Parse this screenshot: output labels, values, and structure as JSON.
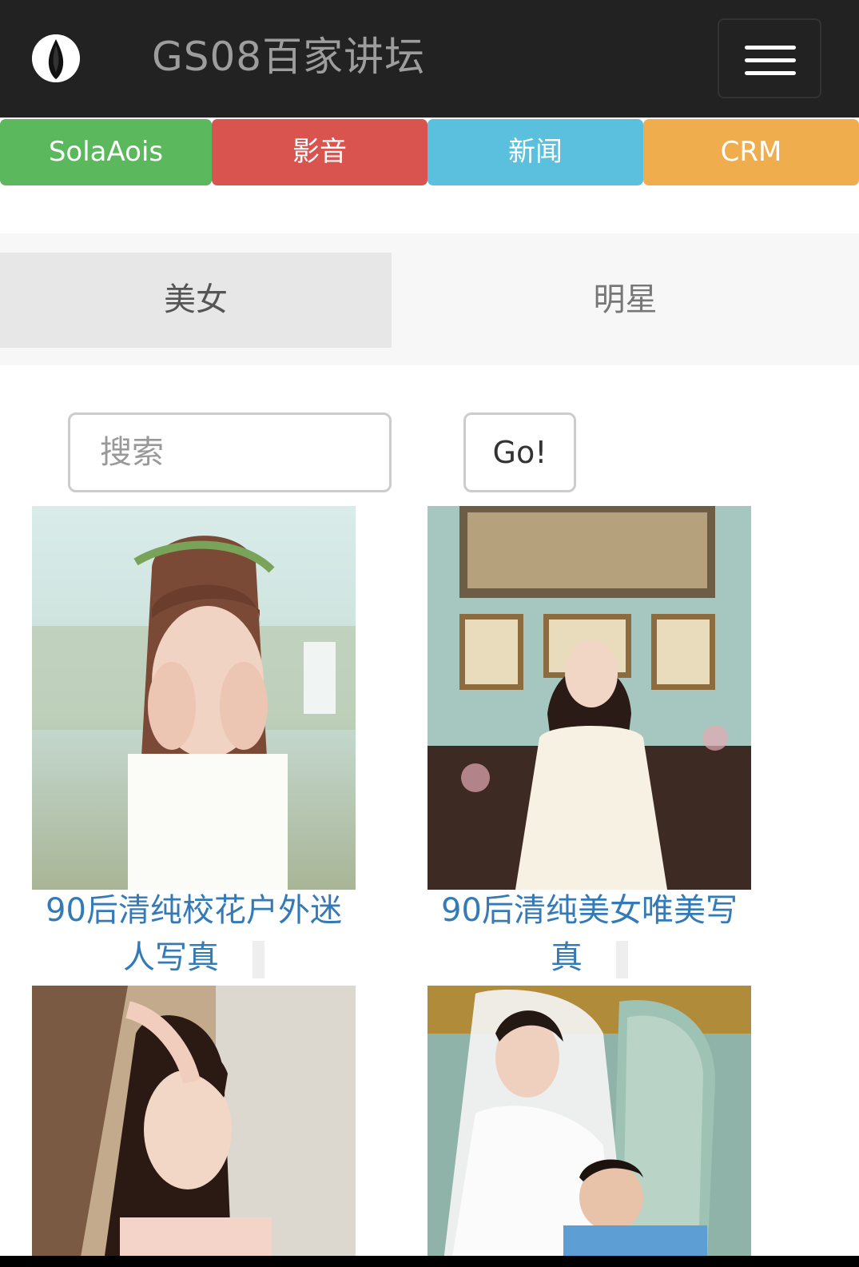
{
  "header": {
    "brand": "GS08百家讲坛",
    "menu_toggle": "hamburger-menu"
  },
  "categories": [
    {
      "label": "SolaAois",
      "color": "#5cb85c"
    },
    {
      "label": "影音",
      "color": "#d9534f"
    },
    {
      "label": "新闻",
      "color": "#5bc0de"
    },
    {
      "label": "CRM",
      "color": "#f0ad4e"
    }
  ],
  "tabs": [
    {
      "label": "美女",
      "active": true
    },
    {
      "label": "明星",
      "active": false
    }
  ],
  "search": {
    "placeholder": "搜索",
    "value": "",
    "button_label": "Go!"
  },
  "gallery": [
    {
      "title": "90后清纯校花户外迷人写真"
    },
    {
      "title": "90后清纯美女唯美写真"
    },
    {
      "title": ""
    },
    {
      "title": ""
    }
  ],
  "colors": {
    "navbar": "#222222",
    "link": "#337ab7"
  }
}
